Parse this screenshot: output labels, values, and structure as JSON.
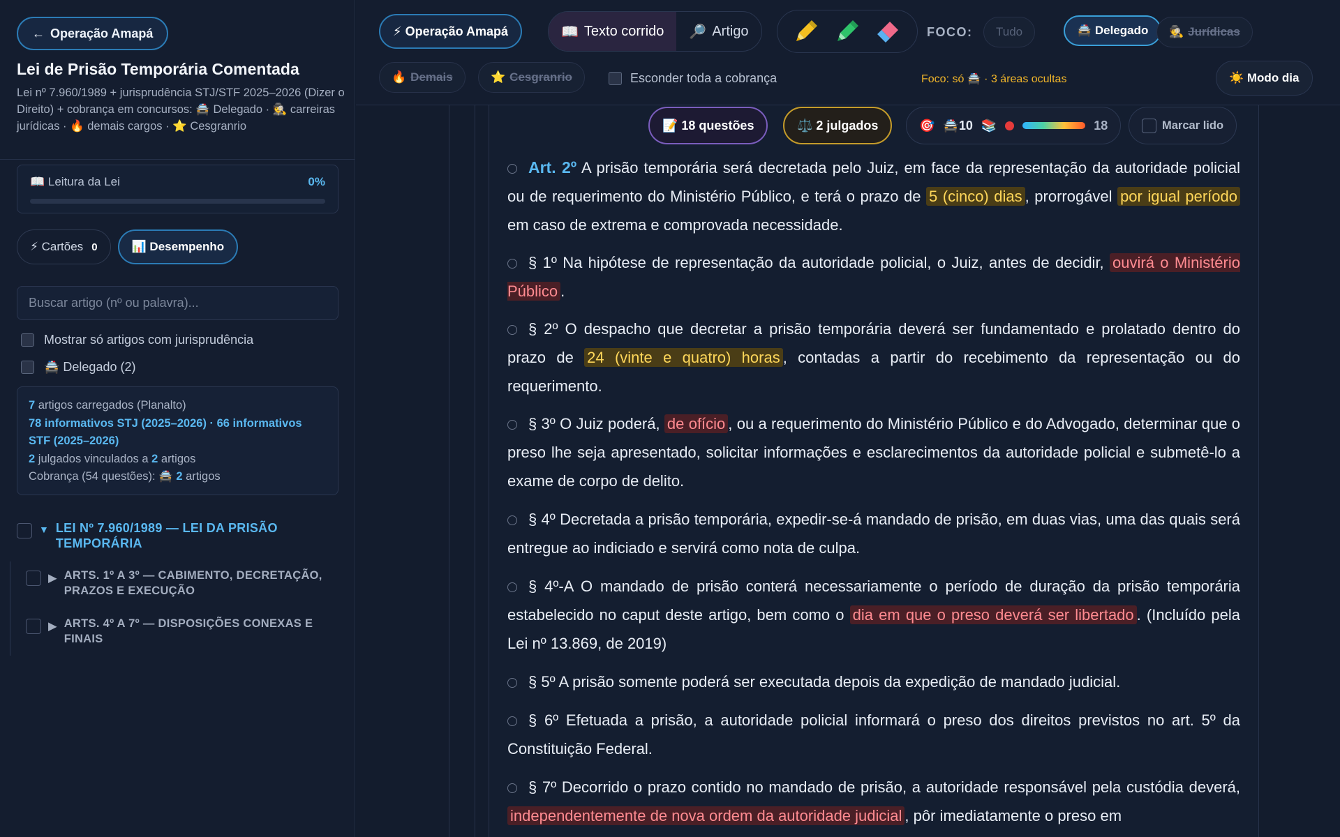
{
  "sidebar": {
    "back_label": "Operação Amapá",
    "title": "Lei de Prisão Temporária Comentada",
    "subtitle": "Lei nº 7.960/1989 + jurisprudência STJ/STF 2025–2026 (Dizer o Direito) + cobrança em concursos: 🚔 Delegado · 🕵️ carreiras jurídicas · 🔥 demais cargos · ⭐ Cesgranrio",
    "progress": {
      "label": "📖 Leitura da Lei",
      "percent_label": "0%",
      "percent": 0
    },
    "pills": {
      "cards_label": "⚡ Cartões",
      "cards_count": "0",
      "performance_label": "📊 Desempenho"
    },
    "search_placeholder": "Buscar artigo (nº ou palavra)...",
    "filter_juris": "Mostrar só artigos com jurisprudência",
    "filter_delegado": "🚔 Delegado (2)",
    "stats": {
      "l1_num": "7",
      "l1_text": " artigos carregados (Planalto)",
      "l2": "78 informativos STJ (2025–2026) · 66 informativos STF (2025–2026)",
      "l3_a": "2",
      "l3_b": " julgados vinculados a ",
      "l3_c": "2",
      "l3_d": " artigos",
      "l4_a": "Cobrança (54 questões): 🚔 ",
      "l4_b": "2",
      "l4_c": " artigos"
    },
    "tree": {
      "root": "LEI Nº 7.960/1989 — LEI DA PRISÃO TEMPORÁRIA",
      "children": [
        "ARTS. 1º A 3º — CABIMENTO, DECRETAÇÃO, PRAZOS E EXECUÇÃO",
        "ARTS. 4º A 7º — DISPOSIÇÕES CONEXAS E FINAIS"
      ]
    }
  },
  "toolbar": {
    "op_label": "⚡ Operação Amapá",
    "mode_text": "Texto corrido",
    "mode_article": "Artigo",
    "foco_label": "FOCO:",
    "chips": {
      "tudo": "Tudo",
      "delegado": "🚔 Delegado",
      "juridicas": "Jurídicas",
      "demais": "Demais",
      "cesgranrio": "Cesgranrio"
    },
    "hide_label": "Esconder toda a cobrança",
    "focus_note": "Foco: só 🚔 · 3 áreas ocultas",
    "day_mode": "☀️ Modo dia"
  },
  "article_meta": {
    "questions": "📝 18 questões",
    "judgments": "⚖️ 2 julgados",
    "score_delegado": "10",
    "score_total": "18",
    "mark_read": "Marcar lido"
  },
  "colors": {
    "accent": "#5ab8f0",
    "highlight_yellow": "#ffd75a",
    "highlight_red": "#ff8b91"
  },
  "article": {
    "art2": {
      "num": "Art. 2º",
      "t1": " A prisão temporária será decretada pelo Juiz, em face da representação da autoridade policial ou de requerimento do Ministério Público, e terá o prazo de ",
      "h1": "5 (cinco) dias",
      "t2": ", prorrogável ",
      "h2": "por igual período",
      "t3": " em caso de extrema e comprovada necessidade."
    },
    "p1": {
      "t1": "§ 1º Na hipótese de representação da autoridade policial, o Juiz, antes de decidir, ",
      "h1": "ouvirá o Ministério Público",
      "t2": "."
    },
    "p2": {
      "t1": "§ 2º O despacho que decretar a prisão temporária deverá ser fundamentado e prolatado dentro do prazo de ",
      "h1": "24 (vinte e quatro) horas",
      "t2": ", contadas a partir do recebimento da representação ou do requerimento."
    },
    "p3": {
      "t1": "§ 3º O Juiz poderá, ",
      "h1": "de ofício",
      "t2": ", ou a requerimento do Ministério Público e do Advogado, determinar que o preso lhe seja apresentado, solicitar informações e esclarecimentos da autoridade policial e submetê-lo a exame de corpo de delito."
    },
    "p4": {
      "t1": "§ 4º Decretada a prisão temporária, expedir-se-á mandado de prisão, em duas vias, uma das quais será entregue ao indiciado e servirá como nota de culpa."
    },
    "p4a": {
      "t1": "§ 4º-A O mandado de prisão conterá necessariamente o período de duração da prisão temporária estabelecido no caput deste artigo, bem como o ",
      "h1": "dia em que o preso deverá ser libertado",
      "t2": ". (Incluído pela Lei nº 13.869, de 2019)"
    },
    "p5": {
      "t1": "§ 5º A prisão somente poderá ser executada depois da expedição de mandado judicial."
    },
    "p6": {
      "t1": "§ 6º Efetuada a prisão, a autoridade policial informará o preso dos direitos previstos no art. 5º da Constituição Federal."
    },
    "p7": {
      "t1": "§ 7º Decorrido o prazo contido no mandado de prisão, a autoridade responsável pela custódia deverá, ",
      "h1": "independentemente de nova ordem da autoridade judicial",
      "t2": ", pôr imediatamente o preso em"
    }
  }
}
